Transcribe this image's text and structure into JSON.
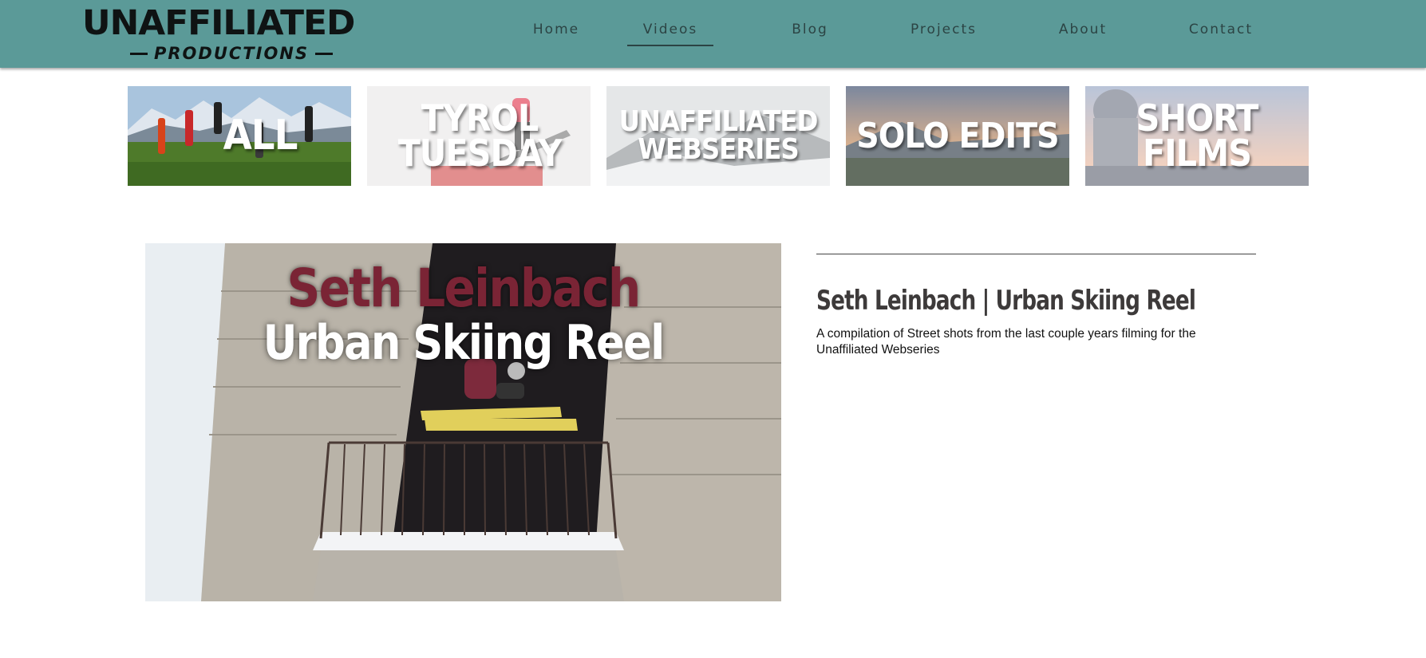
{
  "header": {
    "logo": {
      "top": "UNAFFILIATED",
      "bottom": "PRODUCTIONS"
    },
    "nav": [
      {
        "label": "Home"
      },
      {
        "label": "Videos",
        "active": true
      },
      {
        "label": "Blog"
      },
      {
        "label": "Projects"
      },
      {
        "label": "About"
      },
      {
        "label": "Contact"
      }
    ]
  },
  "categories": [
    {
      "label": "ALL",
      "icon": "jumping-friends-photo"
    },
    {
      "label": "TYROL TUESDAY",
      "icon": "skier-on-rail-photo"
    },
    {
      "label": "UNAFFILIATED WEBSERIES",
      "icon": "snowy-mountain-photo"
    },
    {
      "label": "SOLO EDITS",
      "icon": "mountain-sunset-photo"
    },
    {
      "label": "SHORT FILMS",
      "icon": "capitol-skyline-photo"
    }
  ],
  "featured": {
    "thumbnail_title": "Seth Leinbach",
    "thumbnail_subtitle": "Urban Skiing Reel",
    "title": "Seth Leinbach | Urban Skiing Reel",
    "description": "A compilation of Street shots from the last couple years filming for the Unaffiliated Webseries"
  },
  "colors": {
    "header_bg": "#5b9a98",
    "nav_text": "#2c4444",
    "title_text": "#3d3a3a",
    "thumbnail_accent": "#7a2435"
  }
}
